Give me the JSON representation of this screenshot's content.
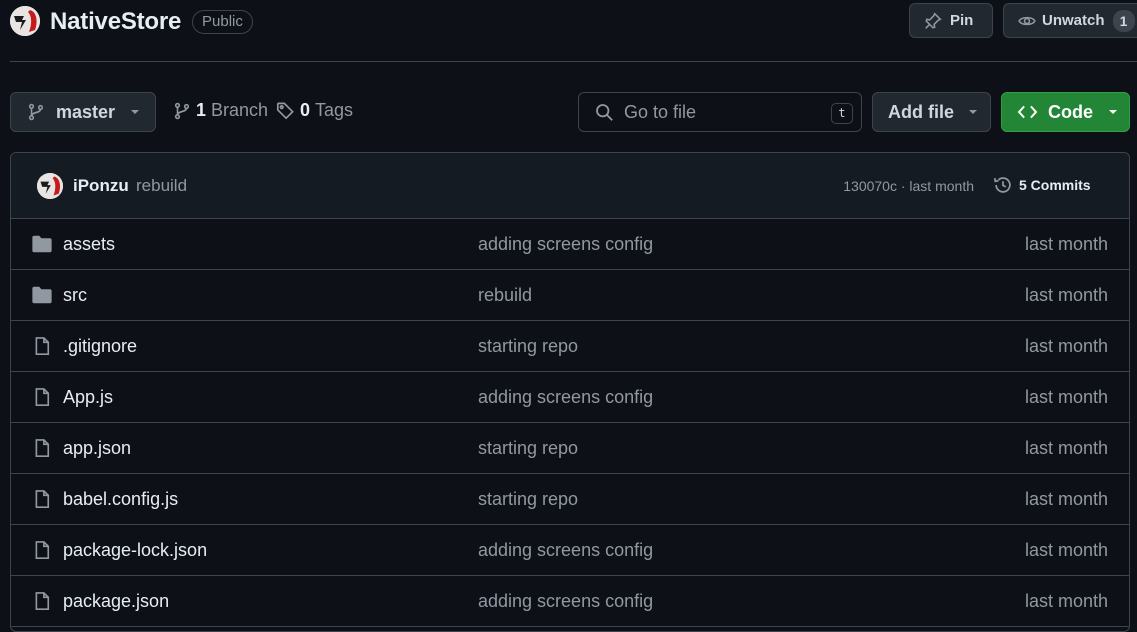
{
  "repo": {
    "name": "NativeStore",
    "visibility": "Public",
    "pin_label": "Pin",
    "watch_label": "Unwatch",
    "watch_count": "1"
  },
  "toolbar": {
    "branch": "master",
    "branches_count": "1",
    "branches_label": "Branch",
    "tags_count": "0",
    "tags_label": "Tags",
    "search_placeholder": "Go to file",
    "search_shortcut": "t",
    "add_file_label": "Add file",
    "code_label": "Code"
  },
  "commit": {
    "author": "iPonzu",
    "message": "rebuild",
    "meta": "130070c · last month",
    "commits_label": "5 Commits"
  },
  "files": [
    {
      "name": "assets",
      "type": "folder",
      "message": "adding screens config",
      "date": "last month"
    },
    {
      "name": "src",
      "type": "folder",
      "message": "rebuild",
      "date": "last month"
    },
    {
      "name": ".gitignore",
      "type": "file",
      "message": "starting repo",
      "date": "last month"
    },
    {
      "name": "App.js",
      "type": "file",
      "message": "adding screens config",
      "date": "last month"
    },
    {
      "name": "app.json",
      "type": "file",
      "message": "starting repo",
      "date": "last month"
    },
    {
      "name": "babel.config.js",
      "type": "file",
      "message": "starting repo",
      "date": "last month"
    },
    {
      "name": "package-lock.json",
      "type": "file",
      "message": "adding screens config",
      "date": "last month"
    },
    {
      "name": "package.json",
      "type": "file",
      "message": "adding screens config",
      "date": "last month"
    }
  ],
  "colors": {
    "background": "#0d1117",
    "border": "#3d444d",
    "accent_green": "#238636",
    "muted_text": "#9198a1"
  }
}
